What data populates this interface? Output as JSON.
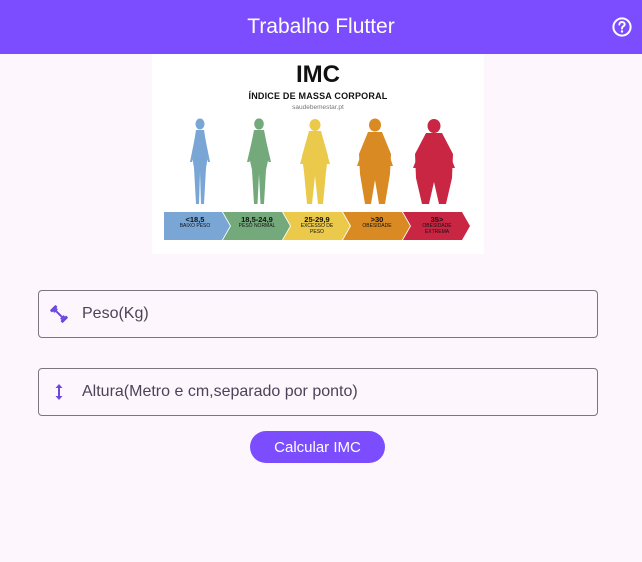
{
  "appbar": {
    "title": "Trabalho Flutter",
    "help_icon": "help-circle-icon"
  },
  "banner": {
    "title": "IMC",
    "subtitle": "ÍNDICE DE MASSA CORPORAL",
    "site": "saudebemestar.pt",
    "categories": [
      {
        "range": "<18,5",
        "name": "BAIXO PESO",
        "color": "#7aa6d6"
      },
      {
        "range": "18,5-24,9",
        "name": "PESO NORMAL",
        "color": "#74a97c"
      },
      {
        "range": "25-29,9",
        "name": "EXCESSO DE PESO",
        "color": "#ebc94b"
      },
      {
        "range": ">30",
        "name": "OBESIDADE",
        "color": "#d98a22"
      },
      {
        "range": "35>",
        "name": "OBESIDADE EXTREMA",
        "color": "#c92644"
      }
    ]
  },
  "form": {
    "peso": {
      "placeholder": "Peso(Kg)",
      "value": "",
      "icon": "dumbbell-icon"
    },
    "altura": {
      "placeholder": "Altura(Metro e cm,separado por ponto)",
      "value": "",
      "icon": "height-arrow-icon"
    },
    "button_label": "Calcular IMC"
  },
  "colors": {
    "primary": "#7c4dff",
    "background": "#fdf7fd"
  }
}
